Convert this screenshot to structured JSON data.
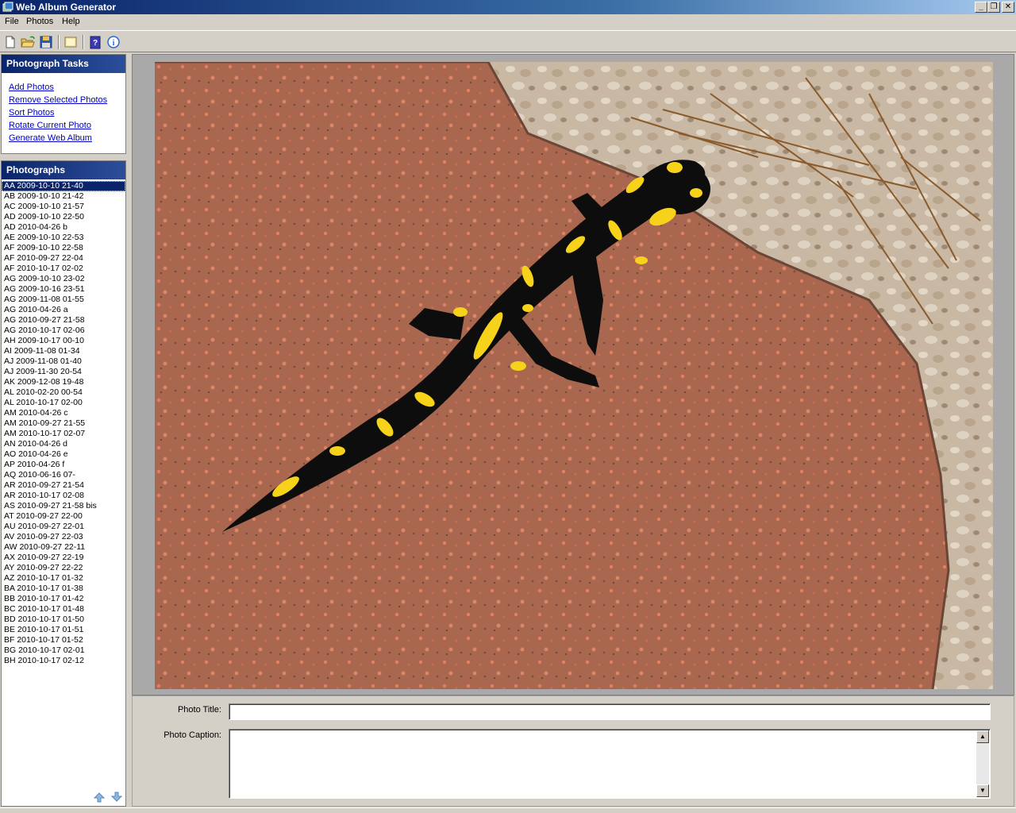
{
  "window": {
    "title": "Web Album Generator"
  },
  "menu": {
    "items": [
      "File",
      "Photos",
      "Help"
    ]
  },
  "toolbar": {
    "buttons": [
      "new-icon",
      "open-icon",
      "save-icon",
      "image-icon",
      "help-book-icon",
      "info-icon"
    ]
  },
  "tasks": {
    "header": "Photograph Tasks",
    "links": [
      "Add Photos",
      "Remove Selected Photos",
      "Sort Photos",
      "Rotate Current Photo",
      "Generate Web Album"
    ]
  },
  "photographs": {
    "header": "Photographs",
    "selected_index": 0,
    "items": [
      "AA 2009-10-10 21-40",
      "AB 2009-10-10 21-42",
      "AC 2009-10-10 21-57",
      "AD 2009-10-10 22-50",
      "AD 2010-04-26 b",
      "AE 2009-10-10 22-53",
      "AF 2009-10-10 22-58",
      "AF 2010-09-27 22-04",
      "AF 2010-10-17 02-02",
      "AG 2009-10-10 23-02",
      "AG 2009-10-16 23-51",
      "AG 2009-11-08 01-55",
      "AG 2010-04-26 a",
      "AG 2010-09-27 21-58",
      "AG 2010-10-17 02-06",
      "AH 2009-10-17 00-10",
      "AI 2009-11-08 01-34",
      "AJ 2009-11-08 01-40",
      "AJ 2009-11-30 20-54",
      "AK 2009-12-08 19-48",
      "AL 2010-02-20 00-54",
      "AL 2010-10-17 02-00",
      "AM 2010-04-26 c",
      "AM 2010-09-27 21-55",
      "AM 2010-10-17 02-07",
      "AN 2010-04-26 d",
      "AO 2010-04-26 e",
      "AP 2010-04-26 f",
      "AQ 2010-06-16 07-",
      "AR 2010-09-27 21-54",
      "AR 2010-10-17 02-08",
      "AS 2010-09-27 21-58 bis",
      "AT 2010-09-27 22-00",
      "AU 2010-09-27 22-01",
      "AV 2010-09-27 22-03",
      "AW 2010-09-27 22-11",
      "AX 2010-09-27 22-19",
      "AY 2010-09-27 22-22",
      "AZ 2010-10-17 01-32",
      "BA 2010-10-17 01-38",
      "BB 2010-10-17 01-42",
      "BC 2010-10-17 01-48",
      "BD 2010-10-17 01-50",
      "BE 2010-10-17 01-51",
      "BF 2010-10-17 01-52",
      "BG 2010-10-17 02-01",
      "BH 2010-10-17 02-12"
    ]
  },
  "form": {
    "title_label": "Photo Title:",
    "title_value": "",
    "caption_label": "Photo Caption:",
    "caption_value": ""
  },
  "colors": {
    "header_bg": "#0a246a",
    "link": "#0000cc",
    "selection": "#0a246a",
    "salamander_yellow": "#f7d21a"
  }
}
